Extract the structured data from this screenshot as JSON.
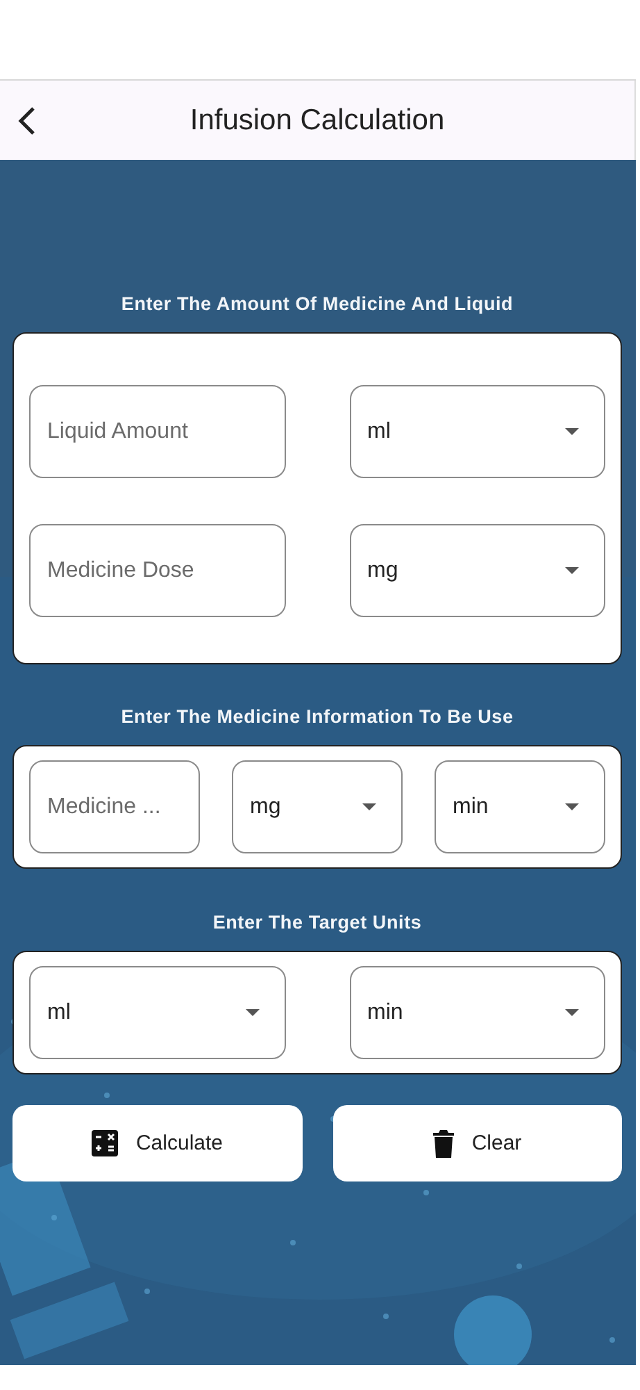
{
  "header": {
    "title": "Infusion Calculation"
  },
  "sections": [
    {
      "title": "Enter The Amount Of Medicine And Liquid",
      "kind": "grid",
      "rows": [
        [
          {
            "kind": "text",
            "placeholder": "Liquid Amount"
          },
          {
            "kind": "select",
            "value": "ml"
          }
        ],
        [
          {
            "kind": "text",
            "placeholder": "Medicine Dose"
          },
          {
            "kind": "select",
            "value": "mg"
          }
        ]
      ]
    },
    {
      "title": "Enter The Medicine Information To Be Use",
      "kind": "row",
      "rows": [
        [
          {
            "kind": "text",
            "placeholder": "Medicine ..."
          },
          {
            "kind": "select",
            "value": "mg"
          },
          {
            "kind": "select",
            "value": "min"
          }
        ]
      ]
    },
    {
      "title": "Enter The Target Units",
      "kind": "row",
      "rows": [
        [
          {
            "kind": "select",
            "value": "ml"
          },
          {
            "kind": "select",
            "value": "min"
          }
        ]
      ]
    }
  ],
  "buttons": [
    {
      "kind": "calculate",
      "label": "Calculate"
    },
    {
      "kind": "clear",
      "label": "Clear"
    }
  ]
}
